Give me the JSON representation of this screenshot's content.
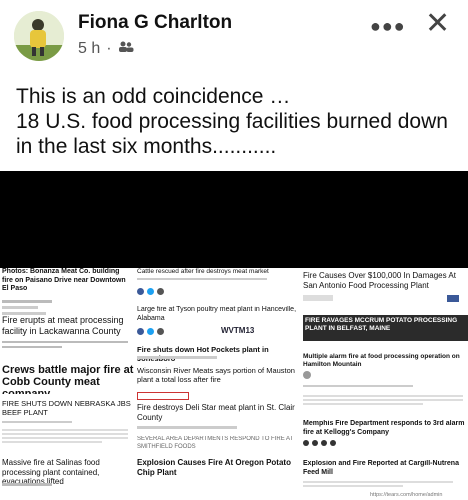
{
  "author": {
    "name": "Fiona G Charlton",
    "time": "5 h"
  },
  "icons": {
    "audience": "friends-icon",
    "more": "more-icon",
    "close": "close-icon"
  },
  "post": {
    "text": "This is an odd coincidence …\n18 U.S. food processing facilities burned down in the last six months..........."
  },
  "cards": {
    "c1": {
      "headline": "Photos: Bonanza Meat Co. building fire on Paisano Drive near Downtown El Paso"
    },
    "c2": {
      "headline": "Fire erupts at meat processing facility in Lackawanna County"
    },
    "c3": {
      "headline": "Crews battle major fire at Cobb County meat company"
    },
    "c4": {
      "headline": "FIRE SHUTS DOWN NEBRASKA JBS BEEF PLANT"
    },
    "c5": {
      "headline": "Massive fire at Salinas food processing plant contained, evacuations lifted"
    },
    "c6": {
      "headline": "Cattle rescued after fire destroys meat market"
    },
    "c7": {
      "headline": "Large fire at Tyson poultry meat plant in Hanceville, Alabama"
    },
    "c8": {
      "headline": "Fire shuts down Hot Pockets plant in Jonesboro"
    },
    "c9": {
      "headline": "Wisconsin River Meats says portion of Mauston plant a total loss after fire"
    },
    "c10": {
      "headline": "Fire destroys Deli Star meat plant in St. Clair County"
    },
    "c11": {
      "headline": "SEVERAL AREA DEPARTMENTS RESPOND TO FIRE AT SMITHFIELD FOODS"
    },
    "c12": {
      "headline": "Explosion Causes Fire At Oregon Potato Chip Plant"
    },
    "c13": {
      "headline": "Fire Causes Over $100,000 In Damages At San Antonio Food Processing Plant"
    },
    "c14": {
      "headline": "FIRE RAVAGES MCCRUM POTATO PROCESSING PLANT IN BELFAST, MAINE"
    },
    "c15": {
      "headline": "Multiple alarm fire at food processing operation on Hamilton Mountain"
    },
    "c16": {
      "headline": "Memphis Fire Department responds to 3rd alarm fire at Kellogg's Company"
    },
    "c17": {
      "headline": "Explosion and Fire Reported at Cargill-Nutrena Feed Mill"
    }
  },
  "logo_text": {
    "wvtm": "WVTM13"
  },
  "watermark": "https://tears.com/home/admin"
}
